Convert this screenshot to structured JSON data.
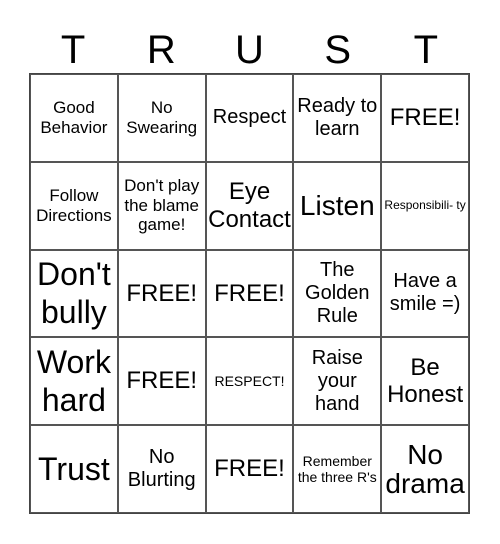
{
  "header": {
    "letters": [
      "T",
      "R",
      "U",
      "S",
      "T"
    ]
  },
  "grid": {
    "rows": [
      [
        "Good Behavior",
        "No Swearing",
        "Respect",
        "Ready to learn",
        "FREE!"
      ],
      [
        "Follow Directions",
        "Don't play the blame game!",
        "Eye Contact",
        "Listen",
        "Responsibili- ty"
      ],
      [
        "Don't bully",
        "FREE!",
        "FREE!",
        "The Golden Rule",
        "Have a smile =)"
      ],
      [
        "Work hard",
        "FREE!",
        "RESPECT!",
        "Raise your hand",
        "Be Honest"
      ],
      [
        "Trust",
        "No Blurting",
        "FREE!",
        "Remember the three R's",
        "No drama"
      ]
    ]
  }
}
